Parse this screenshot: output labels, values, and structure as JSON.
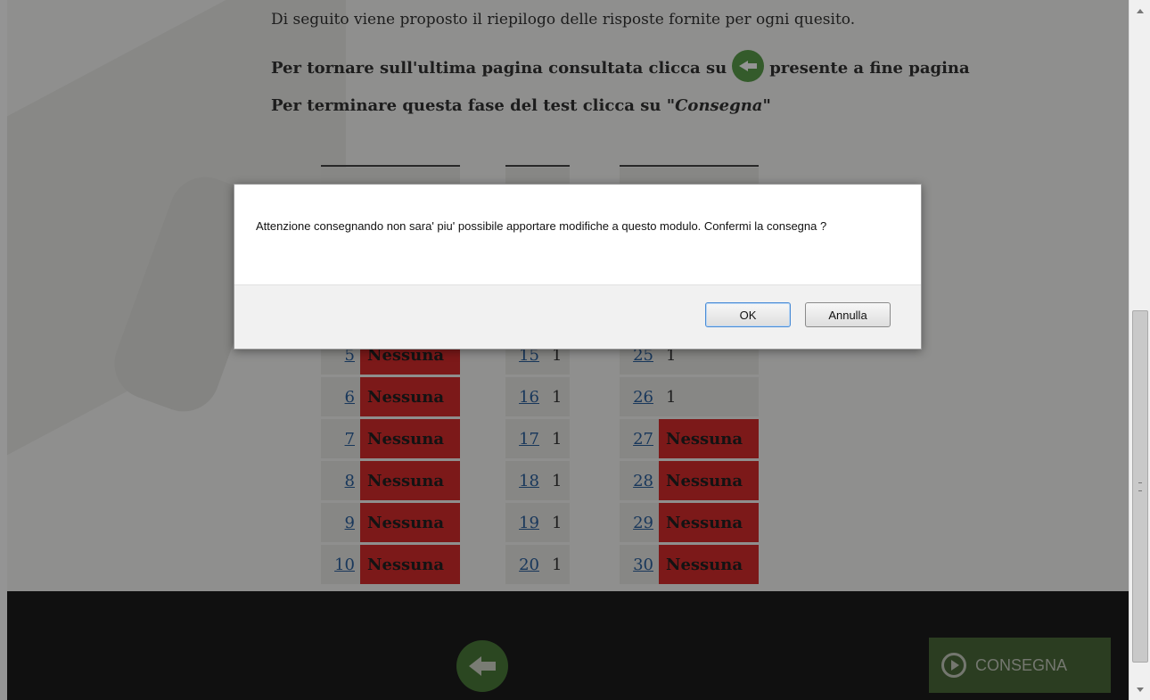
{
  "page": {
    "intro": "Di seguito viene proposto il riepilogo delle risposte fornite per ogni quesito.",
    "line2_before": "Per tornare sull'ultima pagina consultata clicca su",
    "line2_after": "presente a fine pagina",
    "line3_before": "Per terminare questa fase del test clicca su",
    "line3_em": "\"Consegna\"",
    "line3_em_word": "Consegna"
  },
  "columns": [
    {
      "rows": [
        {
          "num": "5",
          "val": "Nessuna",
          "status": "none"
        },
        {
          "num": "6",
          "val": "Nessuna",
          "status": "none"
        },
        {
          "num": "7",
          "val": "Nessuna",
          "status": "none"
        },
        {
          "num": "8",
          "val": "Nessuna",
          "status": "none"
        },
        {
          "num": "9",
          "val": "Nessuna",
          "status": "none"
        },
        {
          "num": "10",
          "val": "Nessuna",
          "status": "none"
        }
      ]
    },
    {
      "rows": [
        {
          "num": "15",
          "val": "1",
          "status": "answered"
        },
        {
          "num": "16",
          "val": "1",
          "status": "answered"
        },
        {
          "num": "17",
          "val": "1",
          "status": "answered"
        },
        {
          "num": "18",
          "val": "1",
          "status": "answered"
        },
        {
          "num": "19",
          "val": "1",
          "status": "answered"
        },
        {
          "num": "20",
          "val": "1",
          "status": "answered"
        }
      ]
    },
    {
      "rows": [
        {
          "num": "25",
          "val": "1",
          "status": "answered"
        },
        {
          "num": "26",
          "val": "1",
          "status": "answered"
        },
        {
          "num": "27",
          "val": "Nessuna",
          "status": "none"
        },
        {
          "num": "28",
          "val": "Nessuna",
          "status": "none"
        },
        {
          "num": "29",
          "val": "Nessuna",
          "status": "none"
        },
        {
          "num": "30",
          "val": "Nessuna",
          "status": "none"
        }
      ]
    }
  ],
  "footer": {
    "back_icon": "back-arrow-icon",
    "consegna_label": "CONSEGNA",
    "consegna_icon": "play-circle-icon"
  },
  "dialog": {
    "message": "Attenzione consegnando non sara' piu' possibile apportare modifiche a questo modulo. Confermi la consegna ?",
    "ok_label": "OK",
    "cancel_label": "Annulla"
  },
  "colors": {
    "none_answer": "#d62b2b",
    "accent_green": "#5a9e4a",
    "footer_bg": "#1c1c1c"
  }
}
